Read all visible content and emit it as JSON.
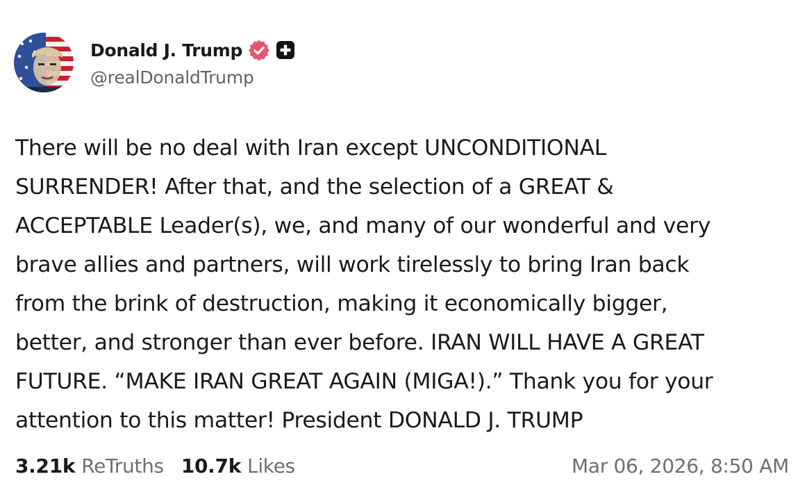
{
  "post": {
    "author": {
      "display_name": "Donald J. Trump",
      "handle": "@realDonaldTrump",
      "avatar_icon": "profile-avatar-flag-portrait",
      "verified_icon": "verified-badge-icon",
      "verified_color": "#e5566f",
      "plus_icon": "plus-square-icon"
    },
    "body_lines": [
      "There will be no deal with Iran except UNCONDITIONAL",
      "SURRENDER! After that, and the selection of a GREAT &",
      "ACCEPTABLE Leader(s), we, and many of our wonderful and very",
      "brave allies and partners, will work tirelessly to bring Iran back",
      "from the brink of destruction, making it economically bigger,",
      "better, and stronger than ever before. IRAN WILL HAVE A GREAT",
      "FUTURE. “MAKE IRAN GREAT AGAIN (MIGA!).” Thank you for your",
      "attention to this matter! President DONALD J. TRUMP"
    ],
    "stats": {
      "retruths_count": "3.21k",
      "retruths_label": "ReTruths",
      "likes_count": "10.7k",
      "likes_label": "Likes"
    },
    "timestamp": "Mar 06, 2026, 8:50 AM"
  }
}
